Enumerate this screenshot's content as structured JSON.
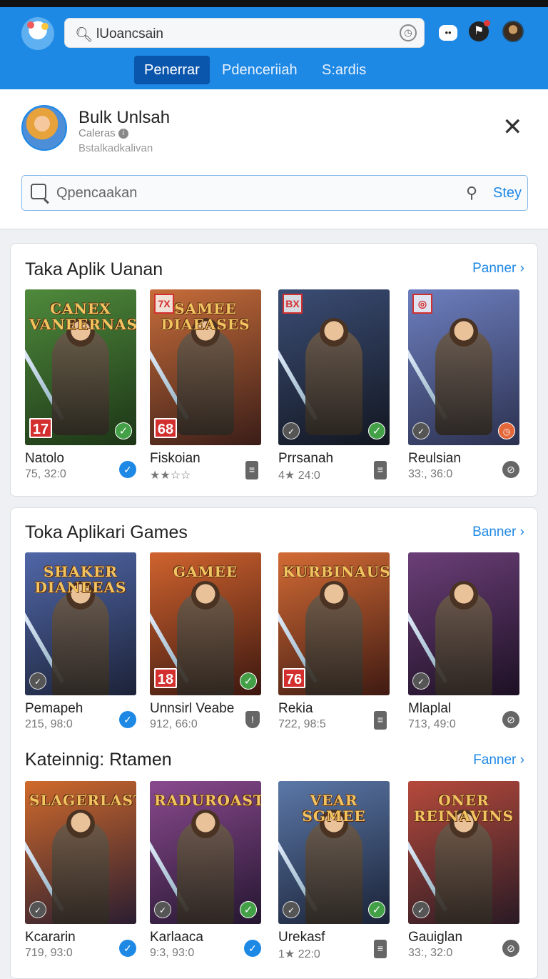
{
  "header": {
    "search_value": "lUoancsain",
    "tabs": [
      "Penerrar",
      "Pdenceriiah",
      "S:ardis"
    ],
    "active_tab": 0
  },
  "profile": {
    "title": "Bulk Unlsah",
    "subtitle": "Caleras",
    "subtitle2": "Bstalkadkalivan",
    "filter_placeholder": "Qpencaakan",
    "filter_button": "Stey"
  },
  "sections": [
    {
      "title": "Taka Aplik Uanan",
      "link": "Panner",
      "apps": [
        {
          "art_title": "CANEX VANEERNAS",
          "name": "Natolo",
          "meta": "75, 32:0",
          "age": "17",
          "corner": "",
          "badge": "ok",
          "action": "blue",
          "colors": [
            "#4f8a3c",
            "#1c3516"
          ]
        },
        {
          "art_title": "SAMEE DIAEASES",
          "name": "Fiskoian",
          "meta": "★★☆☆",
          "age": "68",
          "corner": "7X",
          "badge": "",
          "action": "doc",
          "colors": [
            "#c76d3a",
            "#3a1d18"
          ]
        },
        {
          "art_title": "",
          "name": "Prrsanah",
          "meta": "4★ 24:0",
          "age": "",
          "corner": "BX",
          "badge": "ok",
          "badge_left": true,
          "action": "doc",
          "colors": [
            "#3b4d75",
            "#121620"
          ]
        },
        {
          "art_title": "",
          "name": "Reulsian",
          "meta": "33:, 36:0",
          "age": "",
          "corner": "◎",
          "badge": "orange",
          "badge_left": true,
          "action": "gray",
          "colors": [
            "#6d7fbf",
            "#2c3150"
          ]
        }
      ]
    },
    {
      "title": "Toka Aplikari Games",
      "link": "Banner",
      "apps": [
        {
          "art_title": "SHAKER DIANEEAS",
          "name": "Pemapeh",
          "meta": "215, 98:0",
          "age": "",
          "corner": "",
          "badge": "",
          "badge_left": true,
          "action": "blue",
          "colors": [
            "#5067a8",
            "#1c2238"
          ]
        },
        {
          "art_title": "GAMEE",
          "name": "Unnsirl Veabe",
          "meta": "912, 66:0",
          "age": "18",
          "corner": "",
          "badge": "ok",
          "action": "shield",
          "colors": [
            "#d0632e",
            "#3b1710"
          ]
        },
        {
          "art_title": "KURBINAUS",
          "name": "Rekia",
          "meta": "722, 98:5",
          "age": "76",
          "corner": "",
          "badge": "",
          "action": "doc",
          "colors": [
            "#d36b35",
            "#3f1a12"
          ]
        },
        {
          "art_title": "",
          "name": "Mlaplal",
          "meta": "713, 49:0",
          "age": "",
          "corner": "",
          "badge": "",
          "badge_left": true,
          "action": "gray",
          "colors": [
            "#6b3f78",
            "#1d1024"
          ]
        }
      ]
    },
    {
      "title": "Kateinnig: Rtamen",
      "link": "Fanner",
      "apps": [
        {
          "art_title": "SLAGERLAST",
          "name": "Kcararin",
          "meta": "719, 93:0",
          "age": "",
          "corner": "",
          "badge": "",
          "badge_left": true,
          "action": "blue",
          "colors": [
            "#d06a2c",
            "#2a1d30"
          ]
        },
        {
          "art_title": "RADUROAST",
          "name": "Karlaaca",
          "meta": "9:3, 93:0",
          "age": "",
          "corner": "",
          "badge": "ok",
          "badge_left": true,
          "action": "blue",
          "colors": [
            "#8a4a8e",
            "#241630"
          ]
        },
        {
          "art_title": "VEAR SGMEE",
          "name": "Urekasf",
          "meta": "1★ 22:0",
          "age": "",
          "corner": "",
          "badge": "ok",
          "badge_left": true,
          "action": "doc",
          "colors": [
            "#5b78a8",
            "#1a2236"
          ]
        },
        {
          "art_title": "ONER REINAVINS",
          "name": "Gauiglan",
          "meta": "33:, 32:0",
          "age": "",
          "corner": "",
          "badge": "",
          "badge_left": true,
          "action": "gray",
          "colors": [
            "#b64a3c",
            "#2a1a24"
          ]
        }
      ]
    }
  ],
  "colors": {
    "accent": "#1e88e5",
    "topbar": "#1e88e5",
    "active_tab": "#0b56ad"
  }
}
